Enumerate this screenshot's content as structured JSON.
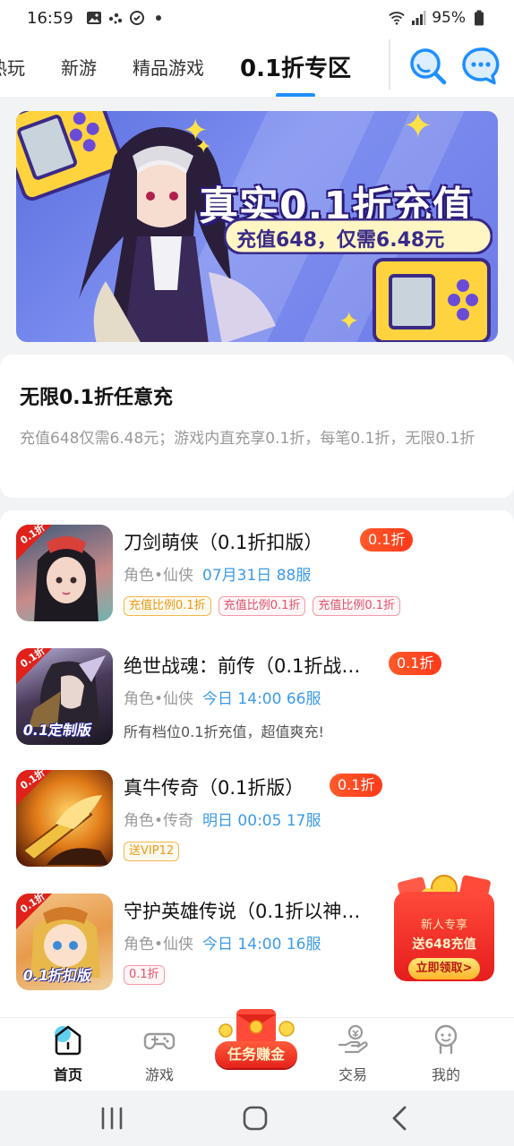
{
  "status_bar": {
    "time": "16:59",
    "battery": "95%",
    "icons": [
      "image-icon",
      "dots-icon",
      "shield-icon",
      "dot-icon",
      "wifi-icon",
      "signal-icon",
      "battery-icon"
    ]
  },
  "top_tabs": [
    {
      "label": "热玩",
      "active": false
    },
    {
      "label": "新游",
      "active": false
    },
    {
      "label": "精品游戏",
      "active": false
    },
    {
      "label": "0.1折专区",
      "active": true
    }
  ],
  "colors": {
    "accent": "#1e8fff",
    "discount_badge": "#ff4a22",
    "server_text": "#3b9be8",
    "tag_orange": "#e89a14",
    "tag_pink": "#e0506a"
  },
  "banner": {
    "headline": "真实0.1折充值",
    "subline": "充值648，仅需6.48元"
  },
  "info_card": {
    "title": "无限0.1折任意充",
    "description": "充值648仅需6.48元；游戏内直充享0.1折，每笔0.1折，无限0.1折"
  },
  "games": [
    {
      "icon_corner": "0.1折",
      "name": "刀剑萌侠（0.1折扣版）",
      "badge": "0.1折",
      "category": "角色•仙侠",
      "server": "07月31日 88服",
      "tags": [
        {
          "text": "充值比例0.1折",
          "style": "orange"
        },
        {
          "text": "充值比例0.1折",
          "style": "pink"
        },
        {
          "text": "充值比例0.1折",
          "style": "pink"
        }
      ]
    },
    {
      "icon_corner": "0.1折",
      "icon_banner": "0.1定制版",
      "name": "绝世战魂：前传（0.1折战…",
      "badge": "0.1折",
      "category": "角色•仙侠",
      "server": "今日 14:00 66服",
      "description": "所有档位0.1折充值，超值爽充!"
    },
    {
      "icon_corner": "0.1折",
      "name": "真牛传奇（0.1折版）",
      "badge": "0.1折",
      "category": "角色•传奇",
      "server": "明日 00:05 17服",
      "tags": [
        {
          "text": "送VIP12",
          "style": "orange"
        }
      ]
    },
    {
      "icon_corner": "0.1折",
      "icon_banner": "0.1折扣版",
      "name": "守护英雄传说（0.1折以神…",
      "category": "角色•仙侠",
      "server": "今日 14:00 16服",
      "tags": [
        {
          "text": "0.1折",
          "style": "pink"
        }
      ]
    }
  ],
  "promo": {
    "line1": "新人专享",
    "line2": "送648充值",
    "button": "立即领取>"
  },
  "bottom_nav": [
    {
      "label": "首页",
      "icon": "home-icon",
      "active": true
    },
    {
      "label": "游戏",
      "icon": "gamepad-icon",
      "active": false
    },
    {
      "label": "任务赚金",
      "icon": "red-envelope-icon",
      "active": false
    },
    {
      "label": "交易",
      "icon": "trade-icon",
      "active": false
    },
    {
      "label": "我的",
      "icon": "profile-icon",
      "active": false
    }
  ]
}
